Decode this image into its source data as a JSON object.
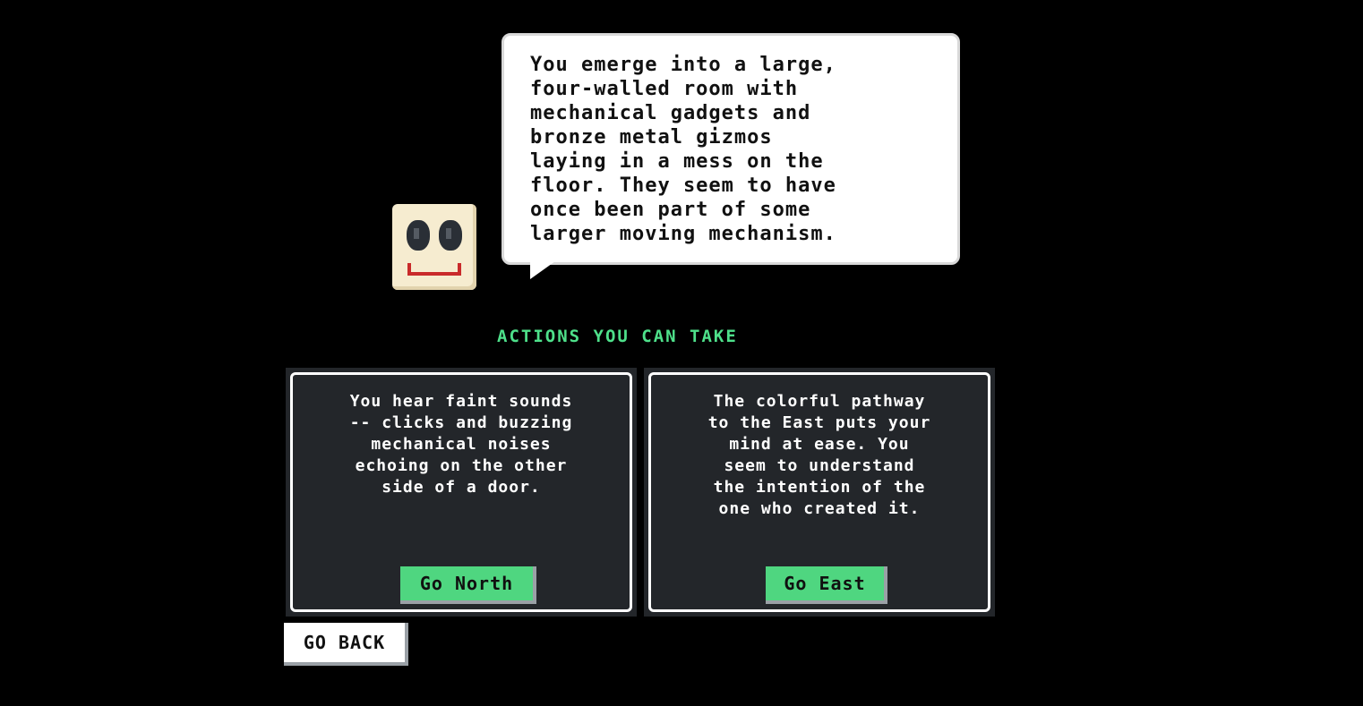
{
  "narration": {
    "text": "You emerge into a large,\nfour-walled room with\nmechanical gadgets and\nbronze metal gizmos\nlaying in a mess on the\nfloor. They seem to have\nonce been part of some\nlarger moving mechanism."
  },
  "actions_heading": "ACTIONS YOU CAN TAKE",
  "actions": [
    {
      "description": "You hear faint sounds\n-- clicks and buzzing\nmechanical noises\nechoing on the other\nside of a door.",
      "button_label": "Go North"
    },
    {
      "description": "The colorful pathway\nto the East puts your\nmind at ease. You\nseem to understand\nthe intention of the\none who created it.",
      "button_label": "Go East"
    }
  ],
  "back_button_label": "GO BACK",
  "colors": {
    "background": "#000000",
    "heading": "#4ee08a",
    "action_button": "#4fd680",
    "card": "#23262a",
    "avatar_face": "#f6ecd0",
    "avatar_mouth": "#c92a2a"
  }
}
